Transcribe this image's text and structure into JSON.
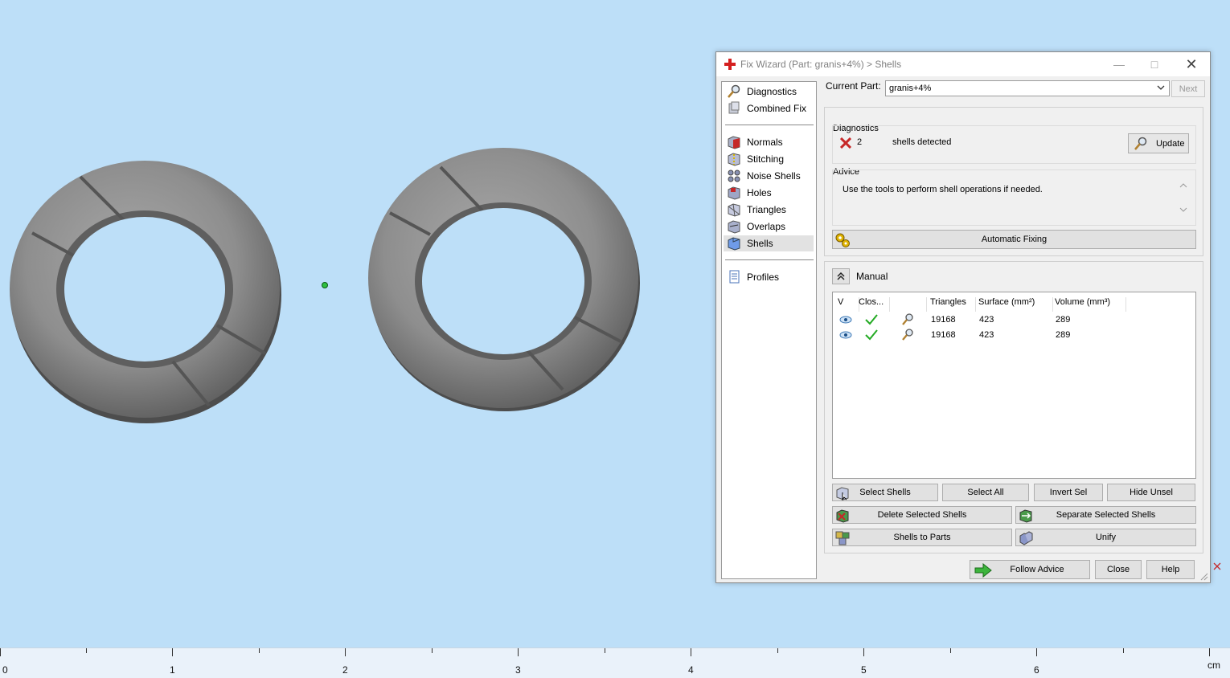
{
  "window": {
    "title": "Fix Wizard (Part: granis+4%) > Shells"
  },
  "nav": {
    "items": [
      {
        "label": "Diagnostics",
        "icon": "magnifier-icon"
      },
      {
        "label": "Combined Fix",
        "icon": "combined-fix-icon"
      },
      {
        "label": "Normals",
        "icon": "normals-icon"
      },
      {
        "label": "Stitching",
        "icon": "stitching-icon"
      },
      {
        "label": "Noise Shells",
        "icon": "noise-shells-icon"
      },
      {
        "label": "Holes",
        "icon": "holes-icon"
      },
      {
        "label": "Triangles",
        "icon": "triangles-icon"
      },
      {
        "label": "Overlaps",
        "icon": "overlaps-icon"
      },
      {
        "label": "Shells",
        "icon": "shells-icon",
        "selected": true
      },
      {
        "label": "Profiles",
        "icon": "profiles-icon"
      }
    ]
  },
  "current_part": {
    "label": "Current Part:",
    "value": "granis+4%",
    "next_label": "Next"
  },
  "diagnostics": {
    "title": "Diagnostics",
    "count": "2",
    "status_text": "shells detected",
    "update_label": "Update",
    "advice_title": "Advice",
    "advice_text": "Use the tools to perform shell operations if needed.",
    "automatic_fixing_label": "Automatic Fixing"
  },
  "manual": {
    "title": "Manual",
    "columns": [
      "V",
      "Clos...",
      "",
      "Triangles",
      "Surface (mm²)",
      "Volume (mm³)"
    ],
    "rows": [
      {
        "triangles": "19168",
        "surface": "423",
        "volume": "289"
      },
      {
        "triangles": "19168",
        "surface": "423",
        "volume": "289"
      }
    ],
    "buttons": {
      "select_shells": "Select Shells",
      "select_all": "Select All",
      "invert_sel": "Invert Sel",
      "hide_unsel": "Hide Unsel",
      "delete_selected": "Delete Selected Shells",
      "separate_selected": "Separate Selected Shells",
      "shells_to_parts": "Shells to Parts",
      "unify": "Unify"
    }
  },
  "footer": {
    "follow_advice": "Follow Advice",
    "close": "Close",
    "help": "Help"
  },
  "ruler": {
    "labels": [
      "0",
      "1",
      "2",
      "3",
      "4",
      "5",
      "6"
    ],
    "unit": "cm"
  },
  "colors": {
    "viewport_bg": "#bddff8",
    "model_gray": "#8c8c8c",
    "accent_red": "#cc2222",
    "check_green": "#22aa22"
  }
}
